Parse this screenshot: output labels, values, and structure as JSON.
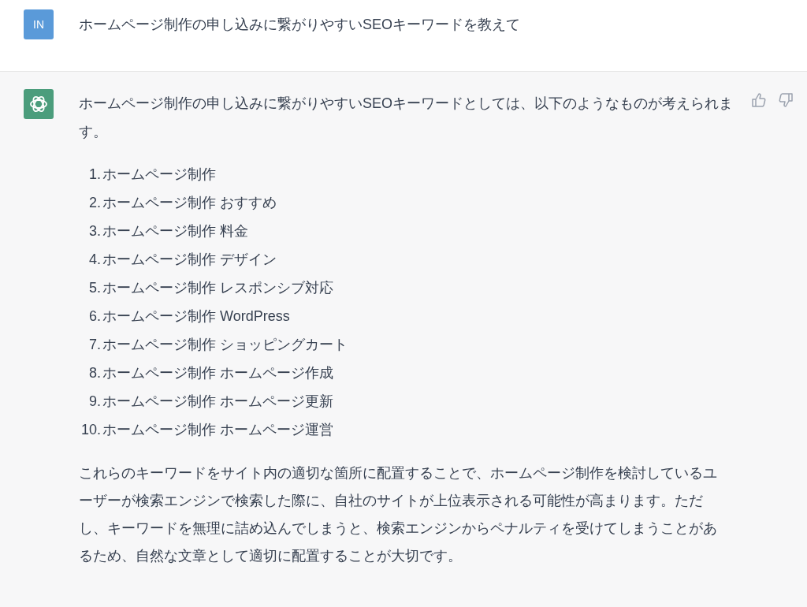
{
  "user_message": {
    "avatar": "IN",
    "text": "ホームページ制作の申し込みに繋がりやすいSEOキーワードを教えて"
  },
  "assistant_message": {
    "intro": "ホームページ制作の申し込みに繋がりやすいSEOキーワードとしては、以下のようなものが考えられます。",
    "list": [
      {
        "number": "1.",
        "text": "ホームページ制作"
      },
      {
        "number": "2.",
        "text": "ホームページ制作 おすすめ"
      },
      {
        "number": "3.",
        "text": "ホームページ制作 料金"
      },
      {
        "number": "4.",
        "text": "ホームページ制作 デザイン"
      },
      {
        "number": "5.",
        "text": "ホームページ制作 レスポンシブ対応"
      },
      {
        "number": "6.",
        "text": "ホームページ制作 WordPress"
      },
      {
        "number": "7.",
        "text": "ホームページ制作 ショッピングカート"
      },
      {
        "number": "8.",
        "text": "ホームページ制作 ホームページ作成"
      },
      {
        "number": "9.",
        "text": "ホームページ制作 ホームページ更新"
      },
      {
        "number": "10.",
        "text": "ホームページ制作 ホームページ運営"
      }
    ],
    "conclusion": "これらのキーワードをサイト内の適切な箇所に配置することで、ホームページ制作を検討しているユーザーが検索エンジンで検索した際に、自社のサイトが上位表示される可能性が高まります。ただし、キーワードを無理に詰め込んでしまうと、検索エンジンからペナルティを受けてしまうことがあるため、自然な文章として適切に配置することが大切です。"
  }
}
